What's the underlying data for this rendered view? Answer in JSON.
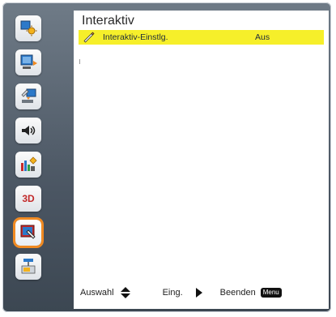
{
  "panel": {
    "title": "Interaktiv"
  },
  "settings": [
    {
      "label": "Interaktiv-Einstlg.",
      "value": "Aus"
    }
  ],
  "footer": {
    "select_label": "Auswahl",
    "enter_label": "Eing.",
    "exit_label": "Beenden",
    "menu_badge": "Menu"
  },
  "sidebar": {
    "items": [
      {
        "icon": "image-settings-icon"
      },
      {
        "icon": "display-settings-icon"
      },
      {
        "icon": "setup-settings-icon"
      },
      {
        "icon": "audio-icon"
      },
      {
        "icon": "options-icon"
      },
      {
        "icon": "three-d-icon",
        "text": "3D"
      },
      {
        "icon": "interactive-icon",
        "active": true
      },
      {
        "icon": "network-icon"
      }
    ]
  },
  "colors": {
    "highlight_row": "#f6ef2a",
    "active_outline": "#f08a22"
  }
}
